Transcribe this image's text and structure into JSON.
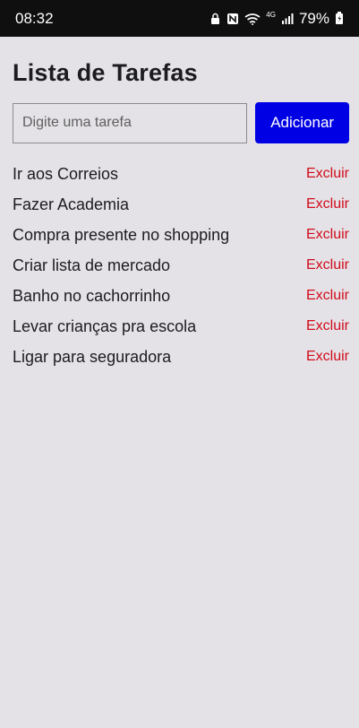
{
  "status_bar": {
    "time": "08:32",
    "network_label": "4G",
    "battery": "79%",
    "colors": {
      "background": "#0f0f10",
      "foreground": "#ffffff"
    },
    "icons": [
      "lock-icon",
      "nfc-icon",
      "wifi-icon",
      "signal-icon",
      "battery-icon"
    ]
  },
  "app": {
    "title": "Lista de Tarefas",
    "input": {
      "placeholder": "Digite uma tarefa",
      "value": ""
    },
    "add_label": "Adicionar",
    "delete_label": "Excluir",
    "colors": {
      "background": "#e4e2e6",
      "primary_button": "#0000e5",
      "delete_text": "#d10b1c"
    }
  },
  "tasks": [
    "Ir aos Correios",
    "Fazer Academia",
    "Compra presente no shopping",
    "Criar lista de mercado",
    "Banho no cachorrinho",
    "Levar crianças pra escola",
    "Ligar para seguradora"
  ]
}
